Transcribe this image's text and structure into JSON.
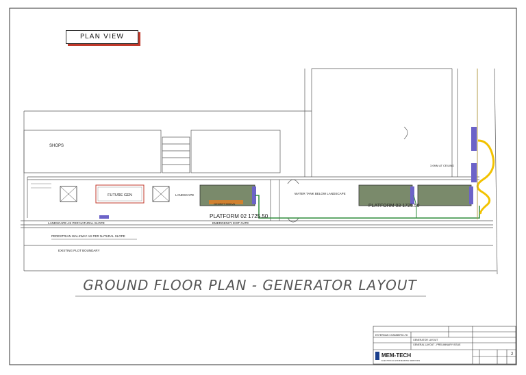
{
  "view_label": "PLAN VIEW",
  "title": "GROUND FLOOR PLAN  -  GENERATOR LAYOUT",
  "labels": {
    "shops": "SHOPS",
    "future_gen": "FUTURE GEN",
    "landscape": "LANDSCAPE",
    "platform_02": "PLATFORM 02 1725.50",
    "platform_03": "PLATFORM 03 1725.50",
    "water_tank": "WATER TANK BELOW LANDSCAPE",
    "emergency_exit": "EMERGENCY EXIT GATE",
    "landscape_slope": "LANDSCAPE AS PER NATURAL SLOPE",
    "pedestrian": "PEDESTRIAN WALKWAY AS PER NATURAL SLOPE",
    "plot_boundary": "EXISTING PLOT BOUNDARY",
    "gen_1": "GENSET 500kVA",
    "ceiling_note": "3.0MM AT CEILING"
  },
  "title_block": {
    "client": "ESTERMAN CHAMBERS LTD",
    "project": "GENERATOR LAYOUT",
    "subtitle": "GENERAL LAYOUT - PRELIMINARY ISSUE",
    "company": "MEM-TECH",
    "tagline": "ELECTRICAL ENGINEERING SERVICES",
    "sheet": "2"
  },
  "colors": {
    "generator": "#7a8a6b",
    "cable_green": "#2e8b3a",
    "cable_yellow": "#f2c200",
    "panel": "#6c63c8",
    "future_frame": "#c0392b"
  }
}
